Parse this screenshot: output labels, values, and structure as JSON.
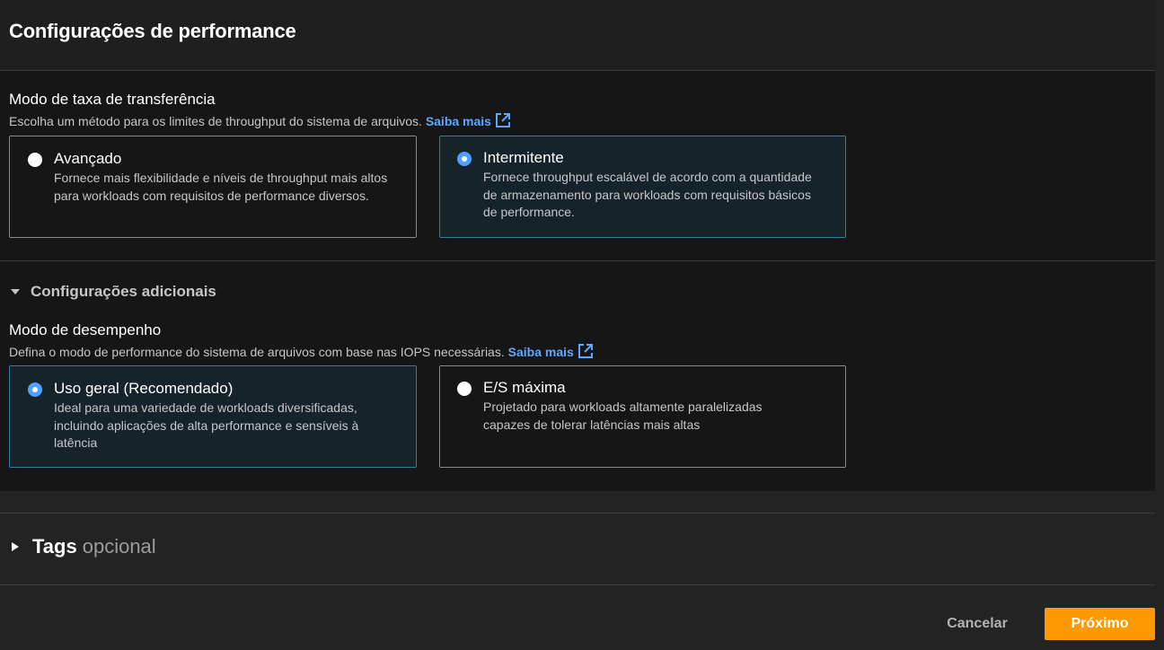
{
  "panel": {
    "title": "Configurações de performance"
  },
  "throughput": {
    "label": "Modo de taxa de transferência",
    "description": "Escolha um método para os limites de throughput do sistema de arquivos.",
    "link": "Saiba mais",
    "options": [
      {
        "title": "Avançado",
        "description": "Fornece mais flexibilidade e níveis de throughput mais altos para workloads com requisitos de performance diversos.",
        "selected": false
      },
      {
        "title": "Intermitente",
        "description": "Fornece throughput escalável de acordo com a quantidade de armazenamento para workloads com requisitos básicos de performance.",
        "selected": true
      }
    ]
  },
  "additional": {
    "label": "Configurações adicionais",
    "expanded": true
  },
  "performance_mode": {
    "label": "Modo de desempenho",
    "description": "Defina o modo de performance do sistema de arquivos com base nas IOPS necessárias.",
    "link": "Saiba mais",
    "options": [
      {
        "title": "Uso geral (Recomendado)",
        "description": "Ideal para uma variedade de workloads diversificadas, incluindo aplicações de alta performance e sensíveis à latência",
        "selected": true
      },
      {
        "title": "E/S máxima",
        "description": "Projetado para workloads altamente paralelizadas capazes de tolerar latências mais altas",
        "selected": false
      }
    ]
  },
  "tags": {
    "title": "Tags",
    "optional": "opcional",
    "expanded": false
  },
  "actions": {
    "cancel": "Cancelar",
    "next": "Próximo"
  },
  "colors": {
    "accent": "#ff9900",
    "link": "#5aa9ff",
    "selected_border": "#2a7ea6",
    "radio_checked": "#4ea1ff"
  }
}
